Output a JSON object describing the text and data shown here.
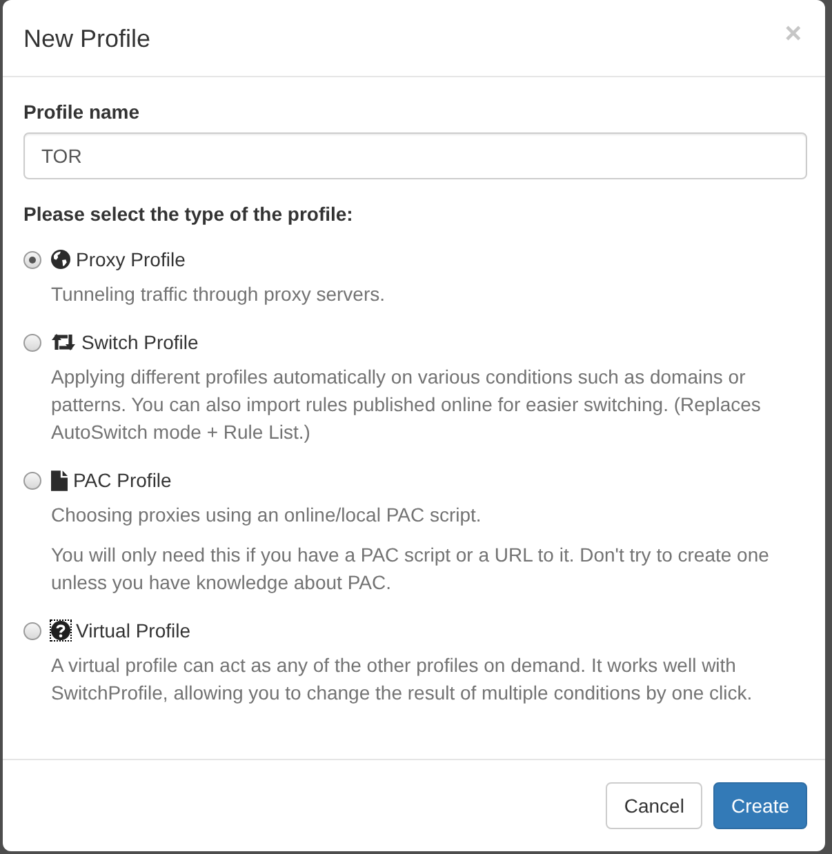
{
  "dialog": {
    "title": "New Profile",
    "close": "×"
  },
  "profile_name": {
    "label": "Profile name",
    "value": "TOR"
  },
  "type_prompt": "Please select the type of the profile:",
  "profile_types": [
    {
      "kind": "proxy",
      "label": "Proxy Profile",
      "selected": true,
      "focused": false,
      "descriptions": [
        "Tunneling traffic through proxy servers."
      ]
    },
    {
      "kind": "switch",
      "label": "Switch Profile",
      "selected": false,
      "focused": false,
      "descriptions": [
        "Applying different profiles automatically on various conditions such as domains or patterns. You can also import rules published online for easier switching. (Replaces AutoSwitch mode + Rule List.)"
      ]
    },
    {
      "kind": "pac",
      "label": "PAC Profile",
      "selected": false,
      "focused": false,
      "descriptions": [
        "Choosing proxies using an online/local PAC script.",
        "You will only need this if you have a PAC script or a URL to it. Don't try to create one unless you have knowledge about PAC."
      ]
    },
    {
      "kind": "virtual",
      "label": "Virtual Profile",
      "selected": false,
      "focused": true,
      "descriptions": [
        "A virtual profile can act as any of the other profiles on demand. It works well with SwitchProfile, allowing you to change the result of multiple conditions by one click."
      ]
    }
  ],
  "buttons": [
    {
      "kind": "default",
      "label": "Cancel"
    },
    {
      "kind": "primary",
      "label": "Create"
    }
  ]
}
